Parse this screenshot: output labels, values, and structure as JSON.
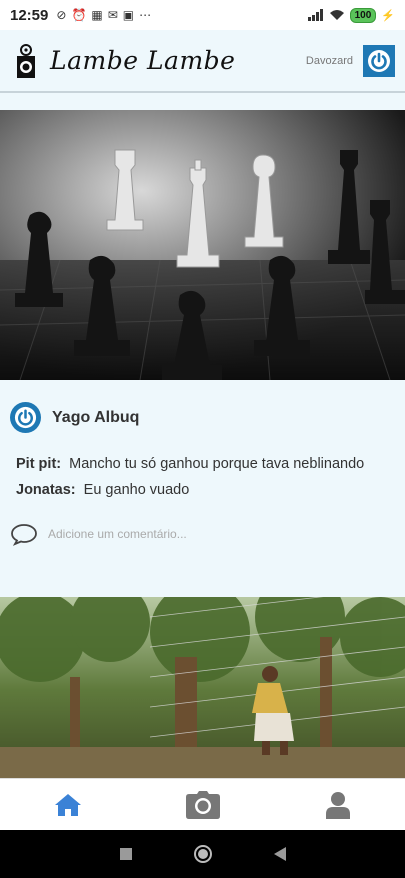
{
  "status": {
    "time": "12:59",
    "battery": "100"
  },
  "header": {
    "brand": "Lambe Lambe",
    "username": "Davozard"
  },
  "post1": {
    "author": "Yago Albuq",
    "comments": [
      {
        "user": "Pit pit:",
        "text": "Mancho tu só ganhou porque tava neblinando"
      },
      {
        "user": "Jonatas:",
        "text": "Eu ganho vuado"
      }
    ],
    "comment_placeholder": "Adicione um comentário..."
  },
  "colors": {
    "background": "#eef8fc",
    "accent_blue": "#1e78b4",
    "active_tab": "#3b82d6",
    "inactive_tab": "#777777"
  },
  "tabs": [
    {
      "icon": "home-icon",
      "active": true
    },
    {
      "icon": "camera-icon",
      "active": false
    },
    {
      "icon": "user-icon",
      "active": false
    }
  ]
}
